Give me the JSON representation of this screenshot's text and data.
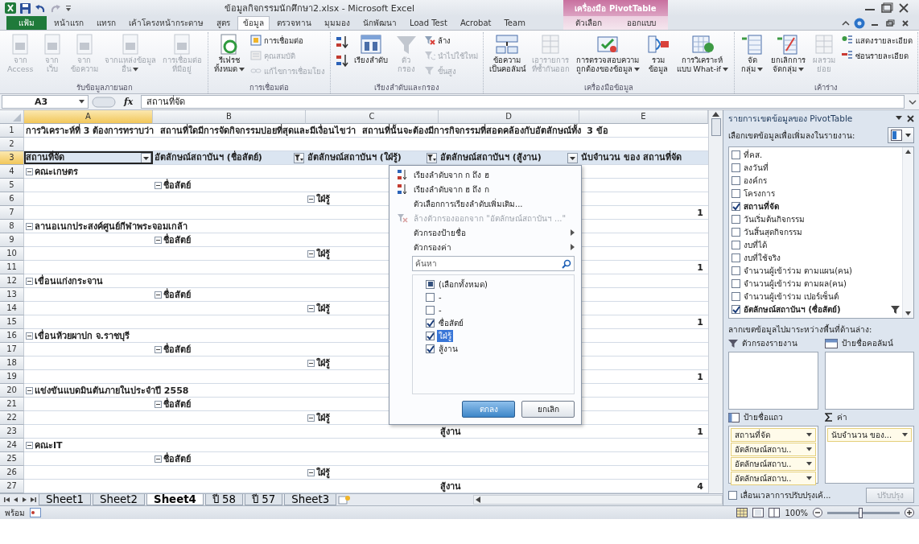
{
  "window": {
    "title": "ข้อมูลกิจกรรมนักศึกษา2.xlsx - Microsoft Excel",
    "context_label": "เครื่องมือ PivotTable"
  },
  "tabs": [
    {
      "label": "แฟ้ม",
      "kind": "file",
      "selected": false
    },
    {
      "label": "หน้าแรก",
      "kind": "normal",
      "selected": false
    },
    {
      "label": "แทรก",
      "kind": "normal",
      "selected": false
    },
    {
      "label": "เค้าโครงหน้ากระดาษ",
      "kind": "normal",
      "selected": false
    },
    {
      "label": "สูตร",
      "kind": "normal",
      "selected": false
    },
    {
      "label": "ข้อมูล",
      "kind": "normal",
      "selected": true
    },
    {
      "label": "ตรวจทาน",
      "kind": "normal",
      "selected": false
    },
    {
      "label": "มุมมอง",
      "kind": "normal",
      "selected": false
    },
    {
      "label": "นักพัฒนา",
      "kind": "normal",
      "selected": false
    },
    {
      "label": "Load Test",
      "kind": "normal",
      "selected": false
    },
    {
      "label": "Acrobat",
      "kind": "normal",
      "selected": false
    },
    {
      "label": "Team",
      "kind": "normal",
      "selected": false
    },
    {
      "label": "ตัวเลือก",
      "kind": "context",
      "selected": false
    },
    {
      "label": "ออกแบบ",
      "kind": "context",
      "selected": false
    }
  ],
  "ribbon": {
    "groups": [
      {
        "label": "รับข้อมูลภายนอก",
        "buttons": [
          {
            "label": "จาก\nAccess",
            "kind": "large",
            "disabled": true,
            "dropdown": false
          },
          {
            "label": "จาก\nเว็บ",
            "kind": "large",
            "disabled": true,
            "dropdown": false
          },
          {
            "label": "จาก\nข้อความ",
            "kind": "large",
            "disabled": true,
            "dropdown": false
          },
          {
            "label": "จากแหล่งข้อมูล\nอื่น",
            "kind": "large",
            "disabled": true,
            "dropdown": true
          },
          {
            "label": "การเชื่อมต่อ\nที่มีอยู่",
            "kind": "large",
            "disabled": true,
            "dropdown": false
          }
        ]
      },
      {
        "label": "การเชื่อมต่อ",
        "buttons": [
          {
            "label": "รีเฟรช\nทั้งหมด",
            "kind": "large",
            "disabled": false,
            "dropdown": true
          },
          {
            "label": "การเชื่อมต่อ",
            "kind": "small",
            "disabled": false,
            "dropdown": false
          },
          {
            "label": "คุณสมบัติ",
            "kind": "small",
            "disabled": true,
            "dropdown": false
          },
          {
            "label": "แก้ไขการเชื่อมโยง",
            "kind": "small",
            "disabled": true,
            "dropdown": false
          }
        ]
      },
      {
        "label": "เรียงลำดับและกรอง",
        "buttons": [
          {
            "kind": "sort-icons"
          },
          {
            "label": "เรียงลำดับ",
            "kind": "large",
            "disabled": false,
            "dropdown": false
          },
          {
            "label": "ตัว\nกรอง",
            "kind": "large",
            "disabled": true,
            "dropdown": false
          },
          {
            "label": "ล้าง",
            "kind": "small",
            "disabled": false,
            "dropdown": false
          },
          {
            "label": "นำไปใช้ใหม่",
            "kind": "small",
            "disabled": true,
            "dropdown": false
          },
          {
            "label": "ขั้นสูง",
            "kind": "small",
            "disabled": true,
            "dropdown": false
          }
        ]
      },
      {
        "label": "เครื่องมือข้อมูล",
        "buttons": [
          {
            "label": "ข้อความ\nเป็นคอลัมน์",
            "kind": "large",
            "disabled": false,
            "dropdown": false
          },
          {
            "label": "เอารายการ\nที่ซ้ำกันออก",
            "kind": "large",
            "disabled": true,
            "dropdown": false
          },
          {
            "label": "การตรวจสอบความ\nถูกต้องของข้อมูล",
            "kind": "large",
            "disabled": false,
            "dropdown": true
          },
          {
            "label": "รวม\nข้อมูล",
            "kind": "large",
            "disabled": false,
            "dropdown": false
          },
          {
            "label": "การวิเคราะห์\nแบบ What-if",
            "kind": "large",
            "disabled": false,
            "dropdown": true
          }
        ]
      },
      {
        "label": "เค้าร่าง",
        "buttons": [
          {
            "label": "จัด\nกลุ่ม",
            "kind": "large",
            "disabled": false,
            "dropdown": true
          },
          {
            "label": "ยกเลิกการ\nจัดกลุ่ม",
            "kind": "large",
            "disabled": false,
            "dropdown": true
          },
          {
            "label": "ผลรวม\nย่อย",
            "kind": "large",
            "disabled": true,
            "dropdown": false
          },
          {
            "label": "แสดงรายละเอียด",
            "kind": "small",
            "disabled": false,
            "dropdown": false
          },
          {
            "label": "ซ่อนรายละเอียด",
            "kind": "small",
            "disabled": false,
            "dropdown": false
          }
        ]
      }
    ]
  },
  "formula_bar": {
    "cell": "A3",
    "function_label": "fx",
    "value": "สถานที่จัด"
  },
  "columns": [
    {
      "label": "A",
      "selected": true
    },
    {
      "label": "B",
      "selected": false
    },
    {
      "label": "C",
      "selected": false
    },
    {
      "label": "D",
      "selected": false
    },
    {
      "label": "E",
      "selected": false
    }
  ],
  "rows": [
    {
      "number": "1",
      "selected": false,
      "cells": {
        "A": {
          "kind": "title",
          "text": "การวิเคราะห์ที่ 3 ต้องการทราบว่า  สถานที่ใดมีการจัดกิจกรรมบ่อยที่สุดและมีเงื่อนไขว่า  สถานที่นั้นจะต้องมีการกิจกรรมที่สอดคล้องกับอัตลักษณ์ทั้ง  3 ข้อ"
        }
      }
    },
    {
      "number": "2",
      "selected": false
    },
    {
      "number": "3",
      "selected": true,
      "cells": {
        "A": {
          "kind": "header",
          "text": "สถานที่จัด",
          "filtered": false,
          "selected": true
        },
        "B": {
          "kind": "header",
          "text": "อัตลักษณ์สถาบันฯ (ชื่อสัตย์)",
          "filtered": true,
          "selected": false
        },
        "C": {
          "kind": "header",
          "text": "อัตลักษณ์สถาบันฯ (ใฝ่รู้)",
          "filtered": true,
          "selected": false
        },
        "D": {
          "kind": "header",
          "text": "อัตลักษณ์สถาบันฯ (สู้งาน)",
          "filtered": false,
          "selected": false
        },
        "E": {
          "kind": "data-header",
          "text": "นับจำนวน ของ สถานที่จัด",
          "selected": false
        }
      }
    },
    {
      "number": "4",
      "selected": false,
      "cells": {
        "A": {
          "kind": "label",
          "text": "คณะเกษตร",
          "expanded": true
        }
      }
    },
    {
      "number": "5",
      "selected": false,
      "cells": {
        "B": {
          "kind": "label",
          "text": "ชื่อสัตย์",
          "expanded": true
        }
      }
    },
    {
      "number": "6",
      "selected": false,
      "cells": {
        "C": {
          "kind": "label",
          "text": "ใฝ่รู้",
          "expanded": true
        }
      }
    },
    {
      "number": "7",
      "selected": false,
      "cells": {
        "E": {
          "kind": "value",
          "text": "1"
        }
      }
    },
    {
      "number": "8",
      "selected": false,
      "cells": {
        "A": {
          "kind": "label",
          "text": "ลานอเนกประสงค์ศูนย์กีฬาพระจอมเกล้า",
          "expanded": true
        }
      }
    },
    {
      "number": "9",
      "selected": false,
      "cells": {
        "B": {
          "kind": "label",
          "text": "ชื่อสัตย์",
          "expanded": true
        }
      }
    },
    {
      "number": "10",
      "selected": false,
      "cells": {
        "C": {
          "kind": "label",
          "text": "ใฝ่รู้",
          "expanded": true
        }
      }
    },
    {
      "number": "11",
      "selected": false,
      "cells": {
        "E": {
          "kind": "value",
          "text": "1"
        }
      }
    },
    {
      "number": "12",
      "selected": false,
      "cells": {
        "A": {
          "kind": "label",
          "text": "เขื่อนแก่งกระจาน",
          "expanded": true
        }
      }
    },
    {
      "number": "13",
      "selected": false,
      "cells": {
        "B": {
          "kind": "label",
          "text": "ชื่อสัตย์",
          "expanded": true
        }
      }
    },
    {
      "number": "14",
      "selected": false,
      "cells": {
        "C": {
          "kind": "label",
          "text": "ใฝ่รู้",
          "expanded": true
        }
      }
    },
    {
      "number": "15",
      "selected": false,
      "cells": {
        "E": {
          "kind": "value",
          "text": "1"
        }
      }
    },
    {
      "number": "16",
      "selected": false,
      "cells": {
        "A": {
          "kind": "label",
          "text": "เขื่อนห้วยผาปก จ.ราชบุรี",
          "expanded": true
        }
      }
    },
    {
      "number": "17",
      "selected": false,
      "cells": {
        "B": {
          "kind": "label",
          "text": "ชื่อสัตย์",
          "expanded": true
        }
      }
    },
    {
      "number": "18",
      "selected": false,
      "cells": {
        "C": {
          "kind": "label",
          "text": "ใฝ่รู้",
          "expanded": true
        }
      }
    },
    {
      "number": "19",
      "selected": false,
      "cells": {
        "E": {
          "kind": "value",
          "text": "1"
        }
      }
    },
    {
      "number": "20",
      "selected": false,
      "cells": {
        "A": {
          "kind": "label",
          "text": "แข่งขันแบดมินตันภายในประจำปี 2558",
          "expanded": true
        }
      }
    },
    {
      "number": "21",
      "selected": false,
      "cells": {
        "B": {
          "kind": "label",
          "text": "ชื่อสัตย์",
          "expanded": true
        }
      }
    },
    {
      "number": "22",
      "selected": false,
      "cells": {
        "C": {
          "kind": "label",
          "text": "ใฝ่รู้",
          "expanded": true
        }
      }
    },
    {
      "number": "23",
      "selected": false,
      "cells": {
        "D": {
          "kind": "item",
          "text": "สู้งาน"
        },
        "E": {
          "kind": "value",
          "text": "1"
        }
      }
    },
    {
      "number": "24",
      "selected": false,
      "cells": {
        "A": {
          "kind": "label",
          "text": "คณะIT",
          "expanded": true
        }
      }
    },
    {
      "number": "25",
      "selected": false,
      "cells": {
        "B": {
          "kind": "label",
          "text": "ชื่อสัตย์",
          "expanded": true
        }
      }
    },
    {
      "number": "26",
      "selected": false,
      "cells": {
        "C": {
          "kind": "label",
          "text": "ใฝ่รู้",
          "expanded": true
        }
      }
    },
    {
      "number": "27",
      "selected": false,
      "cells": {
        "D": {
          "kind": "item",
          "text": "สู้งาน"
        },
        "E": {
          "kind": "value",
          "text": "4"
        }
      }
    }
  ],
  "filter_menu": {
    "items": [
      {
        "label": "เรียงลำดับจาก ก ถึง ฮ",
        "kind": "sort-asc",
        "disabled": false
      },
      {
        "label": "เรียงลำดับจาก ฮ ถึง ก",
        "kind": "sort-desc",
        "disabled": false
      },
      {
        "label": "ตัวเลือกการเรียงลำดับเพิ่มเติม...",
        "kind": "plain",
        "disabled": false
      },
      {
        "label": "ล้างตัวกรองออกจาก \"อัตลักษณ์สถาบันฯ ...\"",
        "kind": "clear",
        "disabled": true
      },
      {
        "label": "ตัวกรองป้ายชื่อ",
        "kind": "submenu",
        "disabled": false
      },
      {
        "label": "ตัวกรองค่า",
        "kind": "submenu",
        "disabled": false
      }
    ],
    "search": {
      "placeholder": "ค้นหา"
    },
    "values": [
      {
        "label": "(เลือกทั้งหมด)",
        "checked": false,
        "mixed": true,
        "selected": false
      },
      {
        "label": "-",
        "checked": false,
        "mixed": false,
        "selected": false
      },
      {
        "label": "-",
        "checked": false,
        "mixed": false,
        "selected": false
      },
      {
        "label": "ซื่อสัตย์",
        "checked": true,
        "mixed": false,
        "selected": false
      },
      {
        "label": "ใฝ่รู้",
        "checked": true,
        "mixed": false,
        "selected": true
      },
      {
        "label": "สู้งาน",
        "checked": true,
        "mixed": false,
        "selected": false
      }
    ],
    "buttons": [
      {
        "label": "ตกลง",
        "default": true
      },
      {
        "label": "ยกเลิก",
        "default": false
      }
    ]
  },
  "sheet_tabs": [
    {
      "label": "Sheet1",
      "selected": false
    },
    {
      "label": "Sheet2",
      "selected": false
    },
    {
      "label": "Sheet4",
      "selected": true
    },
    {
      "label": "ปี 58",
      "selected": false
    },
    {
      "label": "ปี 57",
      "selected": false
    },
    {
      "label": "Sheet3",
      "selected": false
    }
  ],
  "field_pane": {
    "title": "รายการเขตข้อมูลของ PivotTable",
    "prompt": "เลือกเขตข้อมูลเพื่อเพิ่มลงในรายงาน:",
    "fields": [
      {
        "label": "ที่คส.",
        "checked": false,
        "filtered": false
      },
      {
        "label": "ลงวันที่",
        "checked": false,
        "filtered": false
      },
      {
        "label": "องค์กร",
        "checked": false,
        "filtered": false
      },
      {
        "label": "โครงการ",
        "checked": false,
        "filtered": false
      },
      {
        "label": "สถานที่จัด",
        "checked": true,
        "filtered": false
      },
      {
        "label": "วันเริ่มต้นกิจกรรม",
        "checked": false,
        "filtered": false
      },
      {
        "label": "วันสิ้นสุดกิจกรรม",
        "checked": false,
        "filtered": false
      },
      {
        "label": "งบที่ได้",
        "checked": false,
        "filtered": false
      },
      {
        "label": "งบที่ใช้จริง",
        "checked": false,
        "filtered": false
      },
      {
        "label": "จำนวนผู้เข้าร่วม ตามแผน(คน)",
        "checked": false,
        "filtered": false
      },
      {
        "label": "จำนวนผู้เข้าร่วม ตามผล(คน)",
        "checked": false,
        "filtered": false
      },
      {
        "label": "จำนวนผู้เข้าร่วม เปอร์เซ็นต์",
        "checked": false,
        "filtered": false
      },
      {
        "label": "อัตลักษณ์สถาบันฯ (ซื่อสัตย์)",
        "checked": true,
        "filtered": true
      }
    ],
    "areas_prompt": "ลากเขตข้อมูลไปมาระหว่างพื้นที่ด้านล่าง:",
    "areas": [
      {
        "label": "ตัวกรองรายงาน",
        "kind": "filter"
      },
      {
        "label": "ป้ายชื่อคอลัมน์",
        "kind": "columns"
      },
      {
        "label": "ป้ายชื่อแถว",
        "kind": "rows",
        "items": [
          "สถานที่จัด",
          "อัตลักษณ์สถาบ..",
          "อัตลักษณ์สถาบ..",
          "อัตลักษณ์สถาบ.."
        ]
      },
      {
        "label": "ค่า",
        "kind": "values",
        "items": [
          "นับจำนวน ของ..."
        ]
      }
    ],
    "defer": {
      "label": "เลื่อนเวลาการปรับปรุงเค้...",
      "checked": false
    },
    "update_button": {
      "label": "ปรับปรุง",
      "disabled": true
    }
  },
  "status_bar": {
    "text": "พร้อม",
    "zoom": "100%",
    "level": 0.45
  }
}
